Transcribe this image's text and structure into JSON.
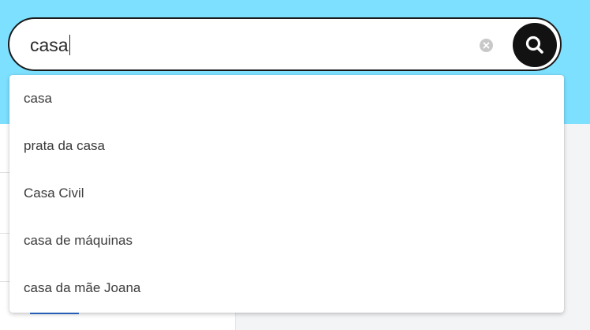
{
  "search": {
    "value": "casa",
    "clear_icon": "clear-x-icon",
    "search_icon": "magnifier-icon"
  },
  "suggestions": [
    "casa",
    "prata da casa",
    "Casa Civil",
    "casa de máquinas",
    "casa da mãe Joana"
  ],
  "colors": {
    "header_background": "#7ee0ff",
    "search_button": "#121212",
    "clear_button": "#c8c8c8",
    "text": "#3a3a3a"
  }
}
